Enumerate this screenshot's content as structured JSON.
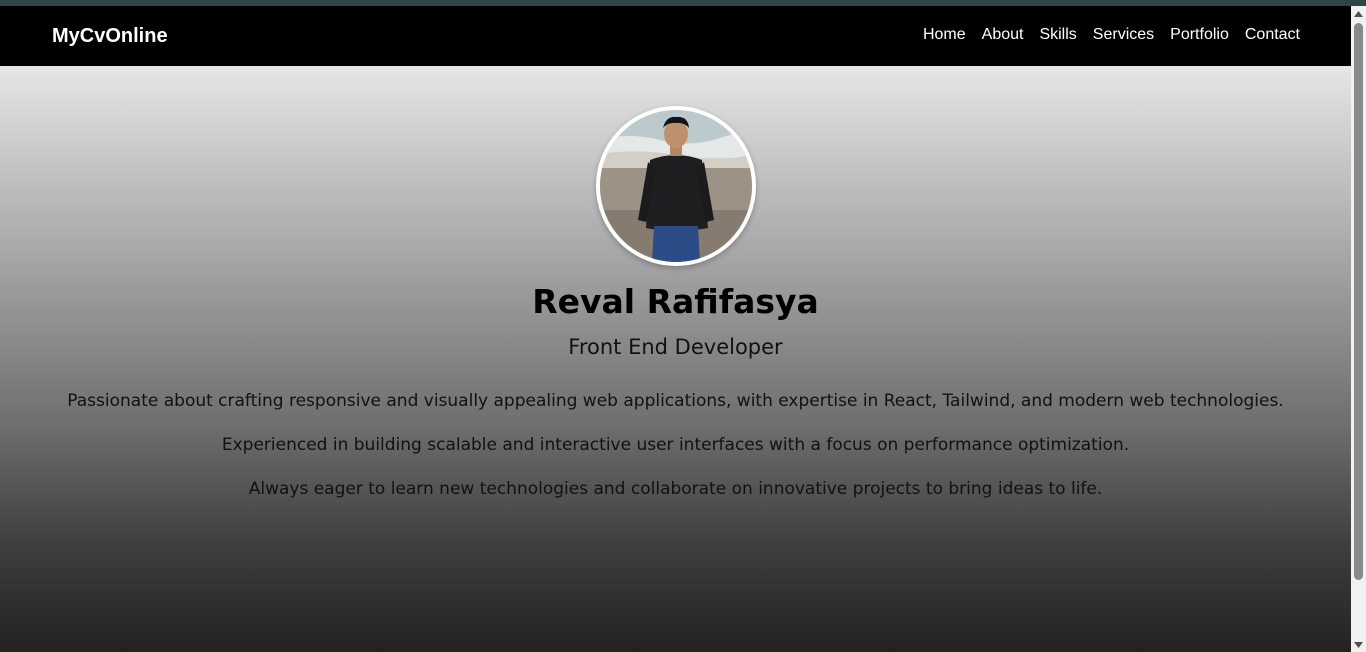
{
  "navbar": {
    "brand": "MyCvOnline",
    "links": [
      "Home",
      "About",
      "Skills",
      "Services",
      "Portfolio",
      "Contact"
    ]
  },
  "hero": {
    "name": "Reval Rafifasya",
    "role": "Front End Developer",
    "bio": [
      "Passionate about crafting responsive and visually appealing web applications, with expertise in React, Tailwind, and modern web technologies.",
      "Experienced in building scalable and interactive user interfaces with a focus on performance optimization.",
      "Always eager to learn new technologies and collaborate on innovative projects to bring ideas to life."
    ]
  },
  "colors": {
    "navbar_bg": "#000000",
    "nav_text": "#ffffff",
    "gradient_top": "#ffffff",
    "gradient_bottom": "#222222"
  },
  "icons": {
    "scroll_up": "scroll-up-arrow-icon",
    "scroll_down": "scroll-down-arrow-icon"
  }
}
